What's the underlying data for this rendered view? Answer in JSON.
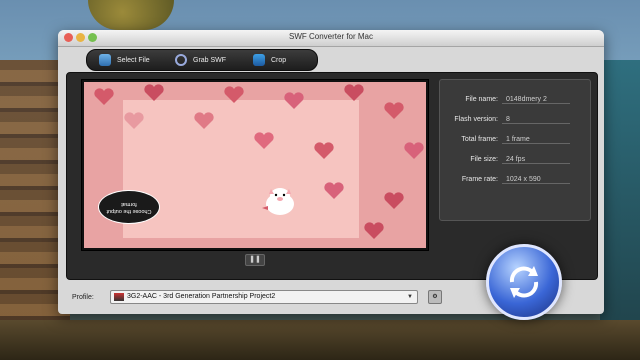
{
  "window": {
    "title": "SWF Converter for Mac"
  },
  "toolbar": {
    "select_file": "Select File",
    "grab_swf": "Grab SWF",
    "crop": "Crop"
  },
  "preview": {
    "bubble_text": "Choose the output format"
  },
  "info": {
    "file_name_label": "File name:",
    "file_name_value": "0148dmery 2",
    "flash_version_label": "Flash version:",
    "flash_version_value": "8",
    "total_frame_label": "Total frame:",
    "total_frame_value": "1 frame",
    "file_size_label": "File size:",
    "file_size_value": "24 fps",
    "frame_rate_label": "Frame rate:",
    "frame_rate_value": "1024 x 590"
  },
  "profile": {
    "label": "Profile:",
    "value": "3G2-AAC - 3rd Generation Partnership Project2"
  },
  "colors": {
    "accent": "#3a66d6",
    "preview_pink": "#e8a3a3"
  },
  "icons": {
    "convert": "convert-icon",
    "pause": "pause-icon"
  }
}
